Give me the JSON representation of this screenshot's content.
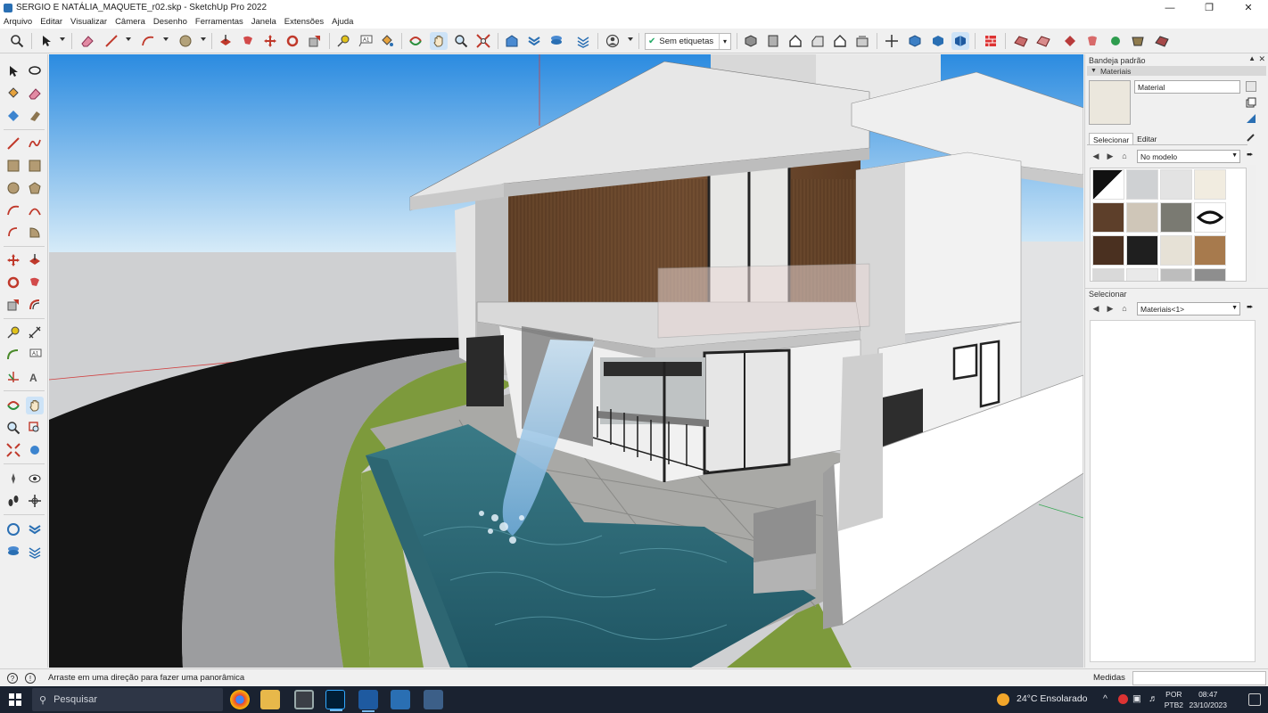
{
  "window": {
    "title": "SERGIO E NATÁLIA_MAQUETE_r02.skp - SketchUp Pro 2022",
    "controls": [
      "minimize-icon",
      "restore-icon",
      "close-icon"
    ]
  },
  "menu": [
    "Arquivo",
    "Editar",
    "Visualizar",
    "Câmera",
    "Desenho",
    "Ferramentas",
    "Janela",
    "Extensões",
    "Ajuda"
  ],
  "toolbar": {
    "tag_selector": "Sem etiquetas"
  },
  "tray": {
    "title": "Bandeja padrão",
    "materials_header": "Materiais",
    "material_name": "Material",
    "tab_select": "Selecionar",
    "tab_edit": "Editar",
    "collection": "No modelo",
    "select_section": "Selecionar",
    "select_collection": "Materiais<1>"
  },
  "status": {
    "hint": "Arraste em uma direção para fazer uma panorâmica",
    "measure_label": "Medidas",
    "measure_value": ""
  },
  "taskbar": {
    "search_placeholder": "Pesquisar",
    "weather": "24°C  Ensolarado",
    "lang_1": "POR",
    "lang_2": "PTB2",
    "time": "08:47",
    "date": "23/10/2023"
  },
  "colors": {
    "accent_active": "#cde3f7",
    "sky_top": "#2e8fe0",
    "sky_bottom": "#cfe6f7",
    "ground": "#cfd0d2",
    "taskbar": "#1a2230"
  }
}
